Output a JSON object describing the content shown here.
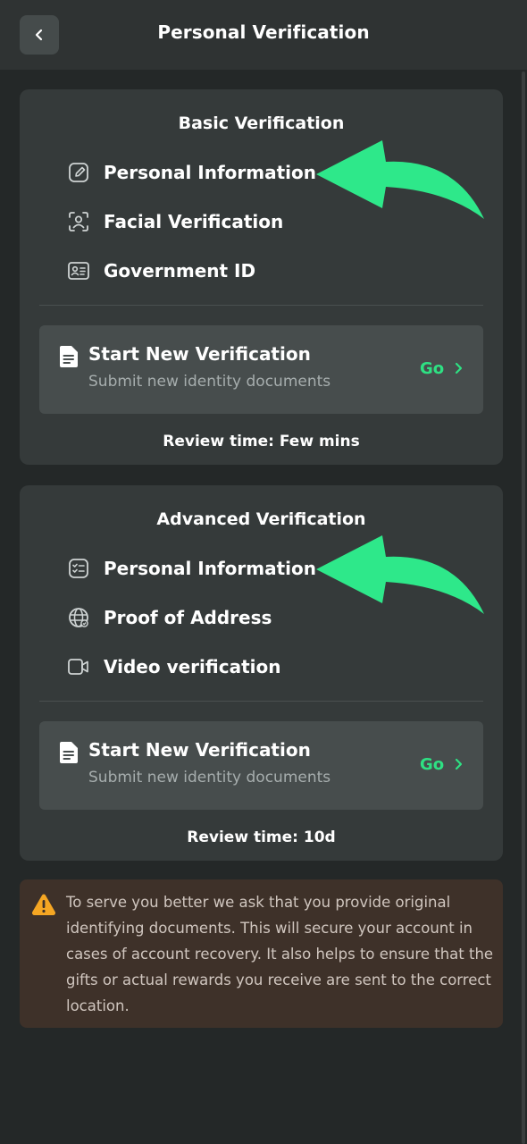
{
  "header": {
    "title": "Personal Verification",
    "back_icon": "chevron-left-icon"
  },
  "basic": {
    "title": "Basic Verification",
    "items": [
      {
        "label": "Personal Information",
        "icon": "edit-icon"
      },
      {
        "label": "Facial Verification",
        "icon": "face-scan-icon"
      },
      {
        "label": "Government ID",
        "icon": "id-card-icon"
      }
    ],
    "action": {
      "title": "Start New Verification",
      "subtitle": "Submit new identity documents",
      "go": "Go"
    },
    "review": "Review time: Few mins"
  },
  "advanced": {
    "title": "Advanced Verification",
    "items": [
      {
        "label": "Personal Information",
        "icon": "checklist-icon"
      },
      {
        "label": "Proof of Address",
        "icon": "globe-icon"
      },
      {
        "label": "Video verification",
        "icon": "video-camera-icon"
      }
    ],
    "action": {
      "title": "Start New Verification",
      "subtitle": "Submit new identity documents",
      "go": "Go"
    },
    "review": "Review time: 10d"
  },
  "notice": {
    "icon": "warning-icon",
    "text": "To serve you better we ask that you provide original identifying documents. This will secure your account in cases of account recovery. It also helps to ensure that the gifts or actual rewards you receive are sent to the correct location."
  },
  "colors": {
    "accent": "#2ee183",
    "background": "#242828",
    "card": "#353a3a",
    "warning": "#f5a623"
  }
}
